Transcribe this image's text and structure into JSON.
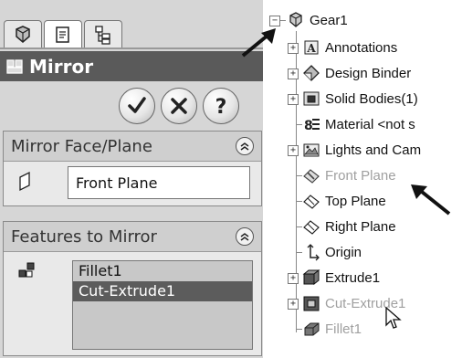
{
  "panel": {
    "tabs": [
      {
        "icon": "feature-manager-icon"
      },
      {
        "icon": "property-manager-icon"
      },
      {
        "icon": "configuration-manager-icon"
      }
    ],
    "title": "Mirror",
    "title_icon": "mirror-icon",
    "buttons": {
      "ok": "ok-check-icon",
      "cancel": "cancel-x-icon",
      "help": "help-question-icon"
    },
    "mirror_group": {
      "heading": "Mirror Face/Plane",
      "value": "Front Plane"
    },
    "features_group": {
      "heading": "Features to Mirror",
      "items": [
        "Fillet1",
        "Cut-Extrude1"
      ],
      "selected_index": 1
    }
  },
  "tree": {
    "root": "Gear1",
    "items": [
      {
        "label": "Annotations",
        "icon": "annotations-icon",
        "expandable": true
      },
      {
        "label": "Design Binder",
        "icon": "design-binder-icon",
        "expandable": true
      },
      {
        "label": "Solid Bodies(1)",
        "icon": "solid-bodies-icon",
        "expandable": true
      },
      {
        "label": "Material <not s",
        "icon": "material-icon",
        "expandable": false
      },
      {
        "label": "Lights and Cam",
        "icon": "lights-camera-icon",
        "expandable": true
      },
      {
        "label": "Front Plane",
        "icon": "plane-icon",
        "expandable": false,
        "dim": true
      },
      {
        "label": "Top Plane",
        "icon": "plane-icon",
        "expandable": false
      },
      {
        "label": "Right Plane",
        "icon": "plane-icon",
        "expandable": false
      },
      {
        "label": "Origin",
        "icon": "origin-icon",
        "expandable": false
      },
      {
        "label": "Extrude1",
        "icon": "extrude-icon",
        "expandable": true
      },
      {
        "label": "Cut-Extrude1",
        "icon": "cut-extrude-icon",
        "expandable": true,
        "dim": true
      },
      {
        "label": "Fillet1",
        "icon": "fillet-icon",
        "expandable": false,
        "dim": true
      }
    ]
  },
  "colors": {
    "title_bar": "#5a5a5a",
    "selected_row": "#5c5c5c",
    "panel_bg": "#d6d6d6"
  }
}
